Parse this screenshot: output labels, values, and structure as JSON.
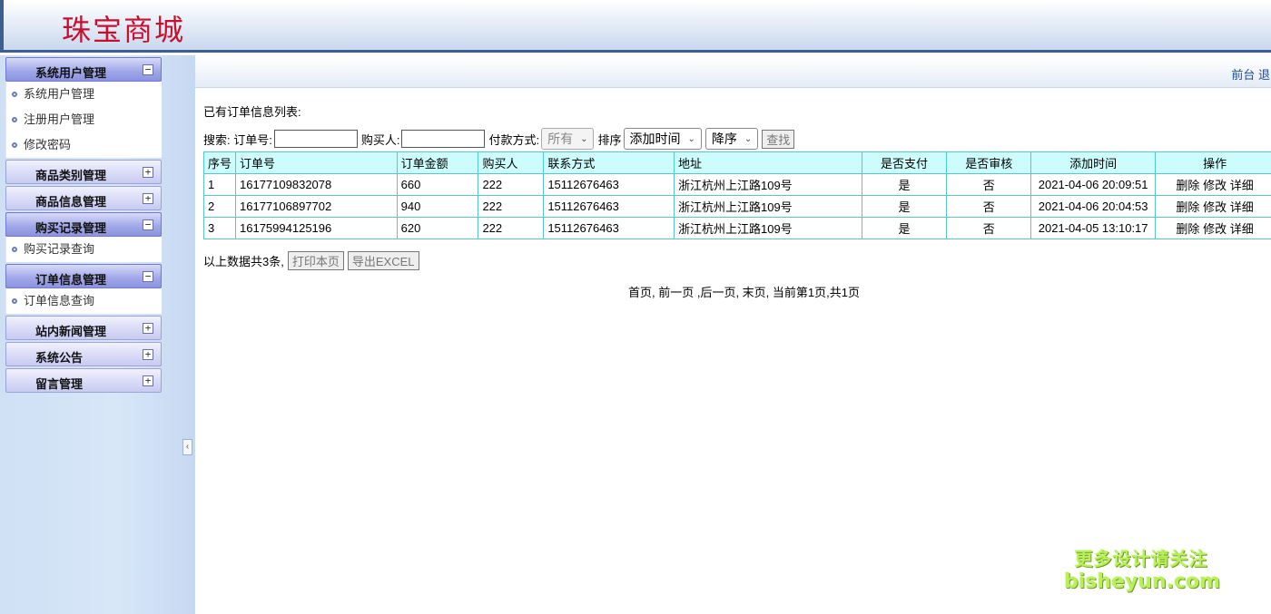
{
  "header": {
    "site_title": "珠宝商城"
  },
  "topbar": {
    "links": "前台 退出"
  },
  "sidebar": {
    "groups": [
      {
        "label": "系统用户管理",
        "state": "expanded",
        "items": [
          "系统用户管理",
          "注册用户管理",
          "修改密码"
        ]
      },
      {
        "label": "商品类别管理",
        "state": "collapsed"
      },
      {
        "label": "商品信息管理",
        "state": "collapsed"
      },
      {
        "label": "购买记录管理",
        "state": "expanded",
        "items": [
          "购买记录查询"
        ]
      },
      {
        "label": "订单信息管理",
        "state": "expanded",
        "items": [
          "订单信息查询"
        ]
      },
      {
        "label": "站内新闻管理",
        "state": "collapsed"
      },
      {
        "label": "系统公告",
        "state": "collapsed"
      },
      {
        "label": "留言管理",
        "state": "collapsed"
      }
    ],
    "collapse_icon": "‹"
  },
  "main": {
    "list_title": "已有订单信息列表:",
    "search": {
      "prefix": "搜索: 订单号:",
      "order_no_value": "",
      "buyer_label": "购买人:",
      "buyer_value": "",
      "payment_label": "付款方式:",
      "payment_selected": "所有",
      "sort_label": "排序",
      "sort_field_selected": "添加时间",
      "sort_order_selected": "降序",
      "find_button": "查找"
    },
    "table": {
      "headers": [
        "序号",
        "订单号",
        "订单金额",
        "购买人",
        "联系方式",
        "地址",
        "是否支付",
        "是否审核",
        "添加时间",
        "操作"
      ],
      "rows": [
        {
          "idx": "1",
          "order_no": "16177109832078",
          "amount": "660",
          "buyer": "222",
          "phone": "15112676463",
          "address": "浙江杭州上江路109号",
          "paid": "是",
          "audited": "否",
          "added": "2021-04-06 20:09:51",
          "delete": "删除",
          "edit": "修改",
          "detail": "详细"
        },
        {
          "idx": "2",
          "order_no": "16177106897702",
          "amount": "940",
          "buyer": "222",
          "phone": "15112676463",
          "address": "浙江杭州上江路109号",
          "paid": "是",
          "audited": "否",
          "added": "2021-04-06 20:04:53",
          "delete": "删除",
          "edit": "修改",
          "detail": "详细"
        },
        {
          "idx": "3",
          "order_no": "16175994125196",
          "amount": "620",
          "buyer": "222",
          "phone": "15112676463",
          "address": "浙江杭州上江路109号",
          "paid": "是",
          "audited": "否",
          "added": "2021-04-05 13:10:17",
          "delete": "删除",
          "edit": "修改",
          "detail": "详细"
        }
      ]
    },
    "summary_text": "以上数据共3条,",
    "print_button": "打印本页",
    "export_button": "导出EXCEL",
    "pager": "首页, 前一页 ,后一页, 末页, 当前第1页,共1页"
  },
  "watermark": {
    "line1": "更多设计请关注",
    "line2": "bisheyun.com"
  },
  "colors": {
    "title_red": "#c8102e",
    "table_border": "#57c8c8",
    "table_header_bg": "#cdfcfc",
    "link_blue": "#1a4f94"
  }
}
